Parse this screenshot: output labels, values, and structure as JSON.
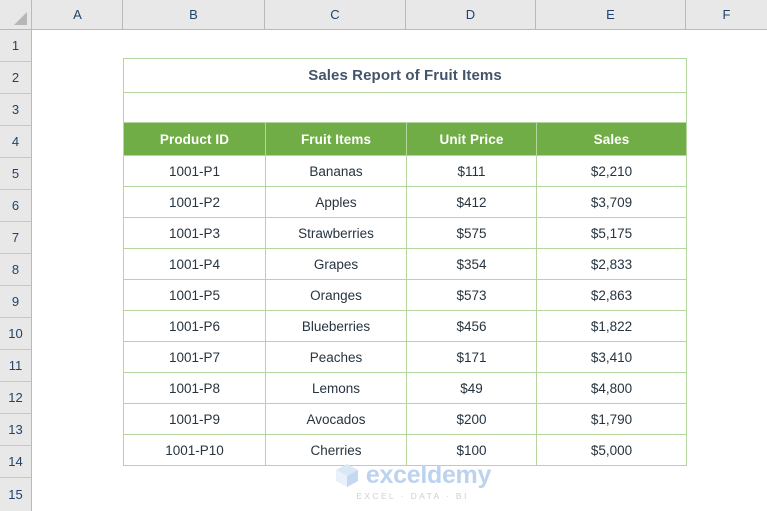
{
  "app": {
    "type": "spreadsheet",
    "select_all_icon": "select-all-triangle-icon"
  },
  "grid": {
    "column_headers": [
      "A",
      "B",
      "C",
      "D",
      "E",
      "F"
    ],
    "row_headers": [
      "1",
      "2",
      "3",
      "4",
      "5",
      "6",
      "7",
      "8",
      "9",
      "10",
      "11",
      "12",
      "13",
      "14",
      "15"
    ]
  },
  "report": {
    "title": "Sales Report of Fruit Items",
    "spacer_row": "",
    "columns": [
      "Product ID",
      "Fruit Items",
      "Unit Price",
      "Sales"
    ],
    "rows": [
      {
        "product_id": "1001-P1",
        "fruit": "Bananas",
        "unit_price": "$111",
        "sales": "$2,210"
      },
      {
        "product_id": "1001-P2",
        "fruit": "Apples",
        "unit_price": "$412",
        "sales": "$3,709"
      },
      {
        "product_id": "1001-P3",
        "fruit": "Strawberries",
        "unit_price": "$575",
        "sales": "$5,175"
      },
      {
        "product_id": "1001-P4",
        "fruit": "Grapes",
        "unit_price": "$354",
        "sales": "$2,833"
      },
      {
        "product_id": "1001-P5",
        "fruit": "Oranges",
        "unit_price": "$573",
        "sales": "$2,863"
      },
      {
        "product_id": "1001-P6",
        "fruit": "Blueberries",
        "unit_price": "$456",
        "sales": "$1,822"
      },
      {
        "product_id": "1001-P7",
        "fruit": "Peaches",
        "unit_price": "$171",
        "sales": "$3,410"
      },
      {
        "product_id": "1001-P8",
        "fruit": "Lemons",
        "unit_price": "$49",
        "sales": "$4,800"
      },
      {
        "product_id": "1001-P9",
        "fruit": "Avocados",
        "unit_price": "$200",
        "sales": "$1,790"
      },
      {
        "product_id": "1001-P10",
        "fruit": "Cherries",
        "unit_price": "$100",
        "sales": "$5,000"
      }
    ]
  },
  "watermark": {
    "brand": "exceldemy",
    "tagline": "EXCEL · DATA · BI",
    "logo_icon": "cube-logo-icon"
  },
  "colors": {
    "header_green": "#70ad47",
    "title_text": "#44546a",
    "data_text": "#27343f",
    "cell_border": "#b5d5a0",
    "gutter_bg": "#e8e8e8",
    "gutter_text": "#20436b",
    "watermark_blue": "#bcd3ef"
  }
}
